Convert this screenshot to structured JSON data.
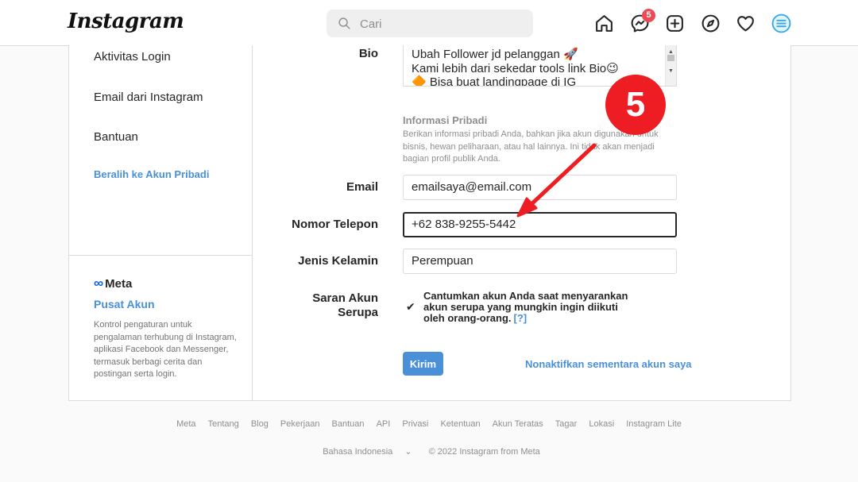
{
  "nav": {
    "logo": "Instagram",
    "search_placeholder": "Cari",
    "messages_badge": "5"
  },
  "sidebar": {
    "items": [
      "Aktivitas Login",
      "Email dari Instagram",
      "Bantuan"
    ],
    "switch_account": "Beralih ke Akun Pribadi",
    "meta_logo": "Meta",
    "meta_center": "Pusat Akun",
    "meta_description": "Kontrol pengaturan untuk pengalaman terhubung di Instagram, aplikasi Facebook dan Messenger, termasuk berbagi cerita dan postingan serta login."
  },
  "form": {
    "bio_label": "Bio",
    "bio_lines": [
      "Ubah Follower jd pelanggan 🚀",
      "Kami lebih dari sekedar tools link Bio😉",
      "🔶 Bisa buat landingpage di IG"
    ],
    "info_title": "Informasi Pribadi",
    "info_desc": "Berikan informasi pribadi Anda, bahkan jika akun digunakan untuk bisnis, hewan peliharaan, atau hal lainnya. Ini tidak akan menjadi bagian profil publik Anda.",
    "email_label": "Email",
    "email_value": "emailsaya@email.com",
    "phone_label": "Nomor Telepon",
    "phone_value": "+62 838-9255-5442",
    "gender_label": "Jenis Kelamin",
    "gender_value": "Perempuan",
    "similar_label_1": "Saran Akun",
    "similar_label_2": "Serupa",
    "similar_text": "Cantumkan akun Anda saat menyarankan akun serupa yang mungkin ingin diikuti oleh orang-orang.",
    "similar_help": "[?]",
    "submit": "Kirim",
    "deactivate": "Nonaktifkan sementara akun saya"
  },
  "annotation": {
    "step": "5"
  },
  "footer": {
    "links": [
      "Meta",
      "Tentang",
      "Blog",
      "Pekerjaan",
      "Bantuan",
      "API",
      "Privasi",
      "Ketentuan",
      "Akun Teratas",
      "Tagar",
      "Lokasi",
      "Instagram Lite"
    ],
    "language": "Bahasa Indonesia",
    "copyright": "© 2022 Instagram from Meta"
  }
}
